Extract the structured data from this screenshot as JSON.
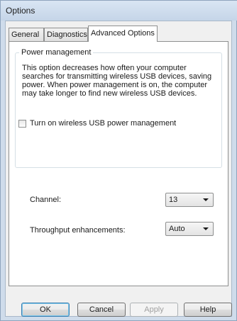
{
  "window": {
    "title": "Options"
  },
  "tabs": [
    {
      "label": "General",
      "selected": false
    },
    {
      "label": "Diagnostics",
      "selected": false
    },
    {
      "label": "Advanced Options",
      "selected": true
    }
  ],
  "power_management": {
    "group_label": "Power management",
    "description": "This option decreases how often your computer searches for transmitting wireless USB devices, saving power. When power management is on, the computer may take longer to find new wireless USB devices.",
    "checkbox_label": "Turn on wireless USB power management",
    "checkbox_checked": false
  },
  "channel": {
    "label": "Channel:",
    "value": "13"
  },
  "throughput": {
    "label": "Throughput enhancements:",
    "value": "Auto"
  },
  "buttons": {
    "ok": "OK",
    "cancel": "Cancel",
    "apply": "Apply",
    "help": "Help"
  },
  "colors": {
    "frame": "#cfdceb",
    "dialog_background": "#f0f0f0",
    "default_button_border": "#3c7fb1"
  }
}
